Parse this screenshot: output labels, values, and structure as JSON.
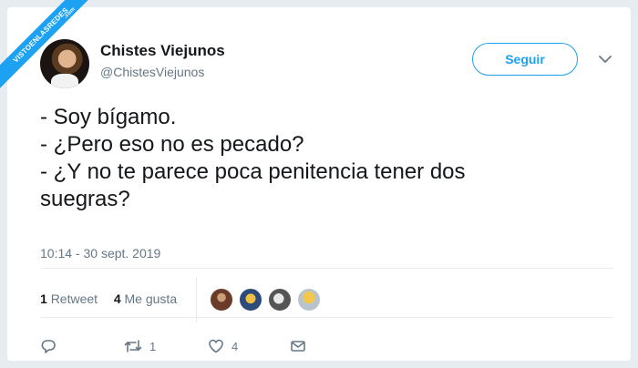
{
  "watermark": {
    "text": "VISTOENLASREDES",
    "sub": ".com"
  },
  "author": {
    "name": "Chistes Viejunos",
    "handle": "@ChistesViejunos"
  },
  "follow_label": "Seguir",
  "tweet_lines": [
    "- Soy bígamo.",
    "- ¿Pero eso no es pecado?",
    "- ¿Y no te parece poca penitencia tener dos",
    "suegras?"
  ],
  "timestamp": "10:14 - 30 sept. 2019",
  "stats": {
    "retweets_count": "1",
    "retweets_label": "Retweet",
    "likes_count": "4",
    "likes_label": "Me gusta"
  },
  "actions": {
    "reply_count": "",
    "retweet_count": "1",
    "like_count": "4"
  },
  "icons": [
    "reply-icon",
    "retweet-icon",
    "like-icon",
    "message-icon",
    "chevron-down-icon"
  ],
  "colors": {
    "accent": "#1da1f2",
    "muted": "#657786",
    "text": "#14171a",
    "border": "#e6ecf0"
  }
}
